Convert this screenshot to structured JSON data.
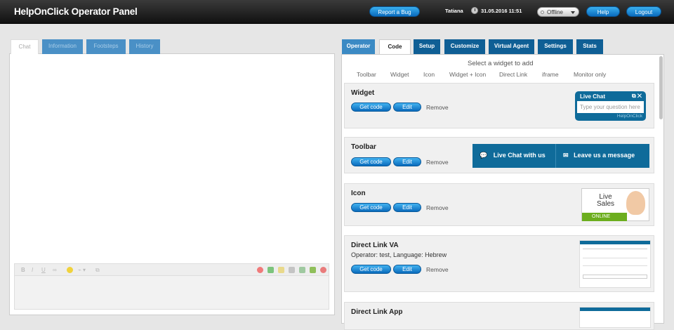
{
  "header": {
    "title": "HelpOnClick Operator Panel",
    "report_bug": "Report a Bug",
    "user": "Tatiana",
    "datetime": "31.05.2016 11:51",
    "status": "Offline",
    "help": "Help",
    "logout": "Logout"
  },
  "left_tabs": [
    "Chat",
    "Information",
    "Footsteps",
    "History"
  ],
  "right_tabs": [
    "Operator",
    "Code",
    "Setup",
    "Customize",
    "Virtual Agent",
    "Settings",
    "Stats"
  ],
  "editor": {
    "bold": "B",
    "italic": "I",
    "underline": "U"
  },
  "widget_select": {
    "heading": "Select a widget to add",
    "types": [
      "Toolbar",
      "Widget",
      "Icon",
      "Widget + Icon",
      "Direct Link",
      "iframe",
      "Monitor only"
    ]
  },
  "cards": [
    {
      "title": "Widget",
      "subtitle": "",
      "get_code": "Get code",
      "edit": "Edit",
      "remove": "Remove"
    },
    {
      "title": "Toolbar",
      "subtitle": "",
      "get_code": "Get code",
      "edit": "Edit",
      "remove": "Remove"
    },
    {
      "title": "Icon",
      "subtitle": "",
      "get_code": "Get code",
      "edit": "Edit",
      "remove": "Remove"
    },
    {
      "title": "Direct Link VA",
      "subtitle": "Operator: test, Language: Hebrew",
      "get_code": "Get code",
      "edit": "Edit",
      "remove": "Remove"
    },
    {
      "title": "Direct Link App",
      "subtitle": "",
      "get_code": "",
      "edit": "",
      "remove": ""
    }
  ],
  "previews": {
    "widget": {
      "title": "Live Chat",
      "placeholder": "Type your question here",
      "brand": "HelpOnClick"
    },
    "toolbar": {
      "chat": "Live Chat with us",
      "message": "Leave us a message"
    },
    "icon": {
      "line1": "Live",
      "line2": "Sales",
      "status": "ONLINE"
    }
  },
  "colors": {
    "accent": "#1a8fd8",
    "dark_tab": "#0f5f95",
    "toolbar_blue": "#0f6b9a",
    "online_green": "#6cae1e"
  }
}
